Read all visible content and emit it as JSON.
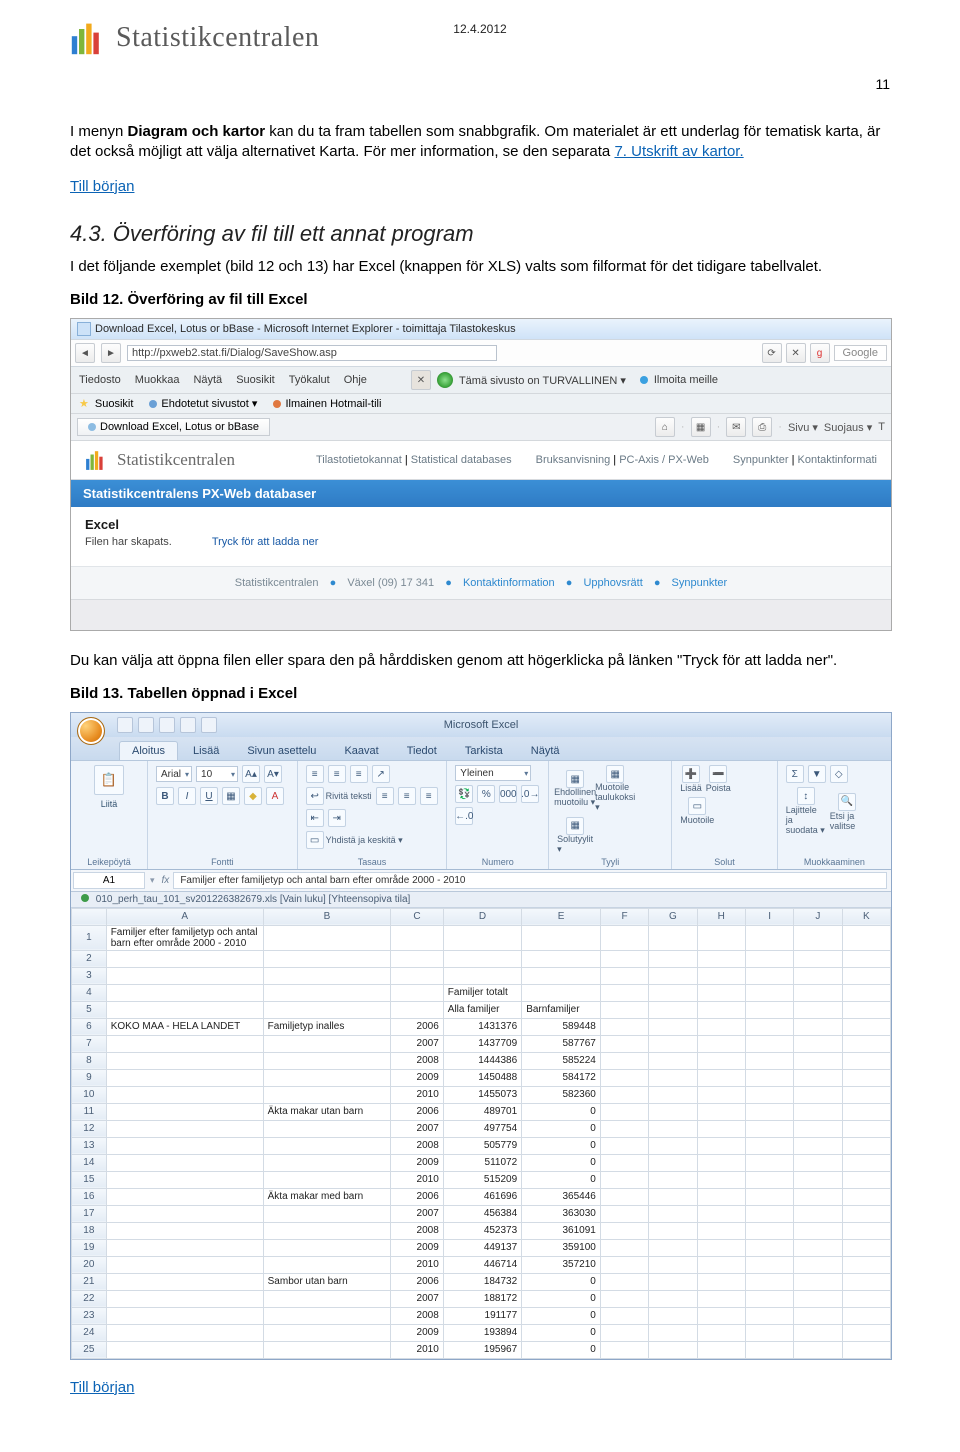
{
  "header": {
    "brand": "Statistikcentralen",
    "date": "12.4.2012",
    "page_number": "11"
  },
  "intro": {
    "p1a": "I menyn ",
    "p1b": "Diagram och kartor",
    "p1c": " kan du ta fram tabellen som snabbgrafik. Om materialet är ett underlag för tematisk karta, är det också möjligt att välja alternativet Karta. För mer information, se den separata ",
    "p1link": "7. Utskrift av kartor.",
    "link_top": "Till början"
  },
  "section": {
    "title": "4.3. Överföring av fil till ett annat program",
    "p": "I det följande exemplet (bild 12 och 13) har Excel (knappen för XLS) valts som filformat för det tidigare tabellvalet.",
    "caption1": "Bild 12. Överföring av fil till Excel"
  },
  "shot1": {
    "title": "Download Excel, Lotus or bBase - Microsoft Internet Explorer - toimittaja Tilastokeskus",
    "url": "http://pxweb2.stat.fi/Dialog/SaveShow.asp",
    "search_ph": "Google",
    "menu": {
      "m1": "Tiedosto",
      "m2": "Muokkaa",
      "m3": "Näytä",
      "m4": "Suosikit",
      "m5": "Työkalut",
      "m6": "Ohje"
    },
    "trust": "Tämä sivusto on TURVALLINEN ▾",
    "report": "Ilmoita meille",
    "fav": {
      "label": "Suosikit",
      "s1": "Ehdotetut sivustot ▾",
      "s2": "Ilmainen Hotmail-tili"
    },
    "tab": "Download Excel, Lotus or bBase",
    "tools": {
      "t1": "Sivu ▾",
      "t2": "Suojaus ▾",
      "t3": "T"
    },
    "brand": "Statistikcentralen",
    "nav": {
      "a": "Tilastotietokannat",
      "b": "Statistical databases",
      "c": "Bruksanvisning",
      "d": "PC-Axis / PX-Web",
      "e": "Synpunkter",
      "f": "Kontaktinformati"
    },
    "bluebar": "Statistikcentralens PX-Web databaser",
    "product": "Excel",
    "created": "Filen har skapats.",
    "download": "Tryck för att ladda ner",
    "footer": {
      "a": "Statistikcentralen",
      "b": "Växel (09) 17 341",
      "c": "Kontaktinformation",
      "d": "Upphovsrätt",
      "e": "Synpunkter"
    }
  },
  "after_shot1": {
    "p": "Du kan välja att öppna filen eller spara den på hårddisken genom att högerklicka på länken \"Tryck för att ladda ner\".",
    "caption2": "Bild 13. Tabellen öppnad i Excel"
  },
  "excel": {
    "apptitle": "Microsoft Excel",
    "tabs": {
      "t1": "Aloitus",
      "t2": "Lisää",
      "t3": "Sivun asettelu",
      "t4": "Kaavat",
      "t5": "Tiedot",
      "t6": "Tarkista",
      "t7": "Näytä"
    },
    "groups": {
      "clipboard": "Leikepöytä",
      "font": "Fontti",
      "align": "Tasaus",
      "number": "Numero",
      "styles": "Tyyli",
      "cells": "Solut",
      "editing": "Muokkaaminen",
      "paste": "Liitä",
      "wrap": "Rivitä teksti",
      "merge": "Yhdistä ja keskitä ▾",
      "general": "Yleinen",
      "cond": "Ehdollinen muotoilu ▾",
      "table": "Muotoile taulukoksi ▾",
      "cellsty": "Solutyylit ▾",
      "ins": "Lisää",
      "del": "Poista",
      "fmt": "Muotoile",
      "sort": "Lajittele ja suodata ▾",
      "find": "Etsi ja valitse"
    },
    "namebox": "A1",
    "formula": "Familjer efter familjetyp och antal barn efter område 2000 - 2010",
    "workbook": "010_perh_tau_101_sv201226382679.xls  [Vain luku]  [Yhteensopiva tila]",
    "columns": [
      "",
      "A",
      "B",
      "C",
      "D",
      "E",
      "F",
      "G",
      "H",
      "I",
      "J",
      "K"
    ],
    "rows": [
      {
        "n": "1",
        "A": "Familjer efter familjetyp och antal barn efter område 2000 - 2010"
      },
      {
        "n": "2"
      },
      {
        "n": "3"
      },
      {
        "n": "4",
        "D": "Familjer totalt"
      },
      {
        "n": "5",
        "D": "Alla familjer",
        "E": "Barnfamiljer"
      },
      {
        "n": "6",
        "A": "KOKO MAA - HELA LANDET",
        "B": "Familjetyp inalles",
        "C": "2006",
        "D": "1431376",
        "E": "589448"
      },
      {
        "n": "7",
        "C": "2007",
        "D": "1437709",
        "E": "587767"
      },
      {
        "n": "8",
        "C": "2008",
        "D": "1444386",
        "E": "585224"
      },
      {
        "n": "9",
        "C": "2009",
        "D": "1450488",
        "E": "584172"
      },
      {
        "n": "10",
        "C": "2010",
        "D": "1455073",
        "E": "582360"
      },
      {
        "n": "11",
        "B": "Äkta makar utan barn",
        "C": "2006",
        "D": "489701",
        "E": "0"
      },
      {
        "n": "12",
        "C": "2007",
        "D": "497754",
        "E": "0"
      },
      {
        "n": "13",
        "C": "2008",
        "D": "505779",
        "E": "0"
      },
      {
        "n": "14",
        "C": "2009",
        "D": "511072",
        "E": "0"
      },
      {
        "n": "15",
        "C": "2010",
        "D": "515209",
        "E": "0"
      },
      {
        "n": "16",
        "B": "Äkta makar med barn",
        "C": "2006",
        "D": "461696",
        "E": "365446"
      },
      {
        "n": "17",
        "C": "2007",
        "D": "456384",
        "E": "363030"
      },
      {
        "n": "18",
        "C": "2008",
        "D": "452373",
        "E": "361091"
      },
      {
        "n": "19",
        "C": "2009",
        "D": "449137",
        "E": "359100"
      },
      {
        "n": "20",
        "C": "2010",
        "D": "446714",
        "E": "357210"
      },
      {
        "n": "21",
        "B": "Sambor utan barn",
        "C": "2006",
        "D": "184732",
        "E": "0"
      },
      {
        "n": "22",
        "C": "2007",
        "D": "188172",
        "E": "0"
      },
      {
        "n": "23",
        "C": "2008",
        "D": "191177",
        "E": "0"
      },
      {
        "n": "24",
        "C": "2009",
        "D": "193894",
        "E": "0"
      },
      {
        "n": "25",
        "C": "2010",
        "D": "195967",
        "E": "0"
      }
    ]
  },
  "bottom_link": "Till början"
}
